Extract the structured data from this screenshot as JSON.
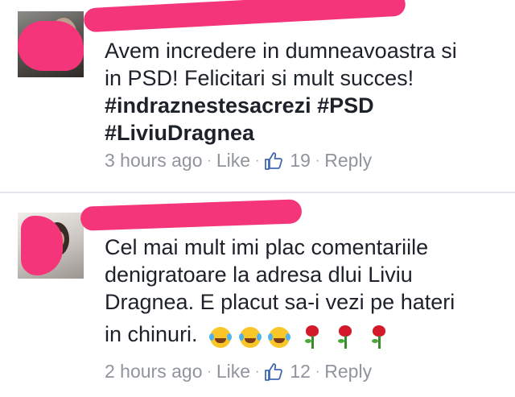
{
  "comments": [
    {
      "lines": [
        "Avem incredere in dumneavoastra si",
        "in PSD! Felicitari si mult succes!"
      ],
      "hashtags": [
        "#indraznestesacrezi #PSD",
        "#LiviuDragnea"
      ],
      "time": "3 hours ago",
      "like_label": "Like",
      "like_count": "19",
      "reply_label": "Reply"
    },
    {
      "lines": [
        "Cel mai mult imi plac comentariile",
        "denigratoare la adresa dlui Liviu",
        "Dragnea. E placut sa-i vezi pe hateri",
        "in chinuri."
      ],
      "time": "2 hours ago",
      "like_label": "Like",
      "like_count": "12",
      "reply_label": "Reply"
    }
  ],
  "separator": "·",
  "icons": {
    "like": "thumbs-up-icon",
    "laugh": "tears-of-joy-icon",
    "rose": "rose-icon"
  },
  "colors": {
    "text": "#1d2129",
    "meta": "#90949c",
    "redaction": "#f5357a",
    "divider": "#e4e6eb"
  }
}
